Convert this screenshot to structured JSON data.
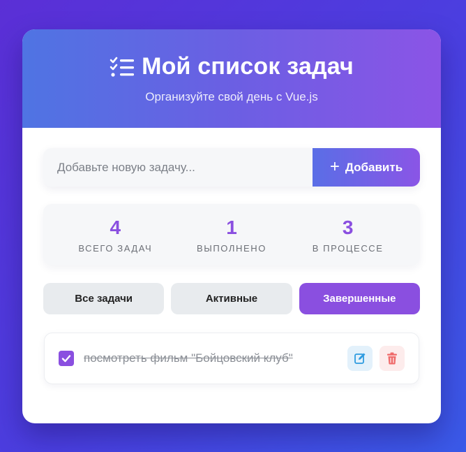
{
  "header": {
    "title": "Мой список задач",
    "subtitle": "Организуйте свой день с Vue.js",
    "title_icon": "tasks-icon"
  },
  "new_task": {
    "placeholder": "Добавьте новую задачу...",
    "value": "",
    "add_label": "Добавить",
    "add_icon": "plus-icon"
  },
  "stats": [
    {
      "value": "4",
      "label": "ВСЕГО ЗАДАЧ"
    },
    {
      "value": "1",
      "label": "ВЫПОЛНЕНО"
    },
    {
      "value": "3",
      "label": "В ПРОЦЕССЕ"
    }
  ],
  "filters": [
    {
      "label": "Все задачи",
      "active": false
    },
    {
      "label": "Активные",
      "active": false
    },
    {
      "label": "Завершенные",
      "active": true
    }
  ],
  "tasks": [
    {
      "text": "посмотреть фильм \"Бойцовский клуб\"",
      "completed": true
    }
  ],
  "colors": {
    "accent": "#8a4fe0",
    "header_start": "#4f74e3",
    "header_end": "#8b54e6",
    "edit": "#2e9be0",
    "delete": "#ef6b6b"
  }
}
